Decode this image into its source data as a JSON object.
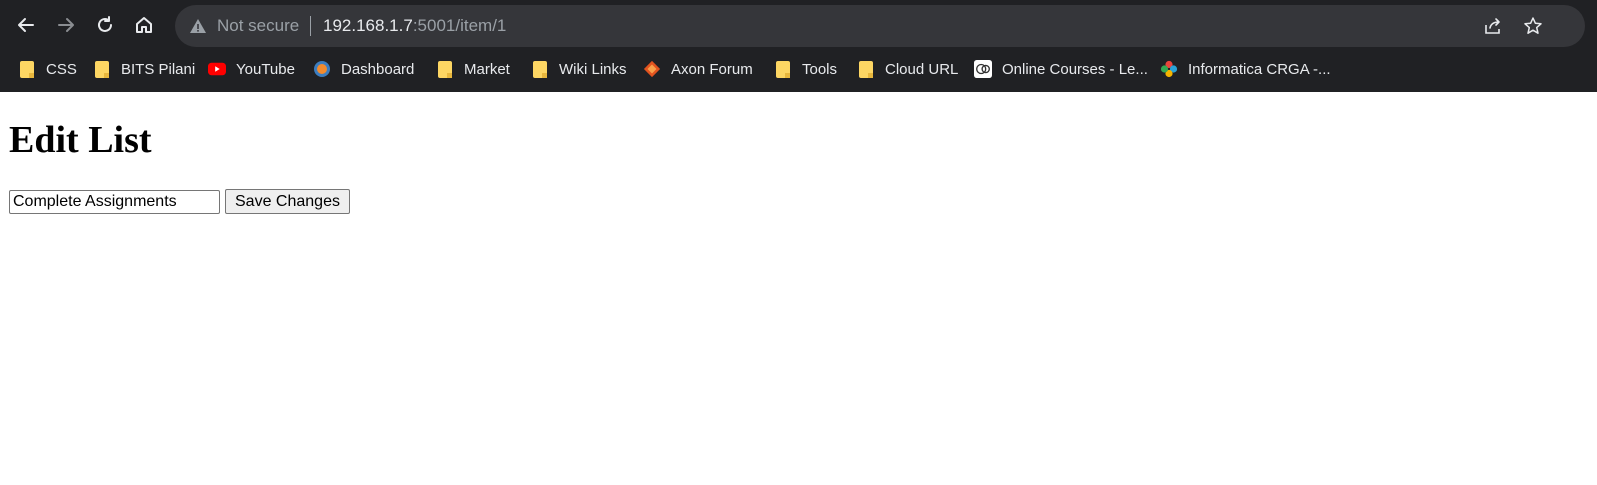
{
  "browser": {
    "security_label": "Not secure",
    "url_host": "192.168.1.7",
    "url_rest": ":5001/item/1",
    "icons": {
      "back": "back-arrow-icon",
      "forward": "forward-arrow-icon",
      "reload": "reload-icon",
      "home": "home-icon",
      "warning": "warning-icon",
      "share": "share-icon",
      "star": "star-icon"
    }
  },
  "bookmarks": [
    {
      "label": "CSS",
      "icon": "folder"
    },
    {
      "label": "BITS Pilani",
      "icon": "folder"
    },
    {
      "label": "YouTube",
      "icon": "youtube"
    },
    {
      "label": "Dashboard",
      "icon": "dashboard"
    },
    {
      "label": "Market",
      "icon": "folder"
    },
    {
      "label": "Wiki Links",
      "icon": "folder"
    },
    {
      "label": "Axon Forum",
      "icon": "axon"
    },
    {
      "label": "Tools",
      "icon": "folder"
    },
    {
      "label": "Cloud URL",
      "icon": "folder"
    },
    {
      "label": "Online Courses - Le...",
      "icon": "courses"
    },
    {
      "label": "Informatica CRGA -...",
      "icon": "informatica"
    }
  ],
  "page": {
    "title": "Edit List",
    "item_value": "Complete Assignments",
    "save_label": "Save Changes"
  },
  "colors": {
    "chrome_bg": "#202124",
    "omnibox_bg": "#35363a",
    "folder": "#fdd663"
  }
}
